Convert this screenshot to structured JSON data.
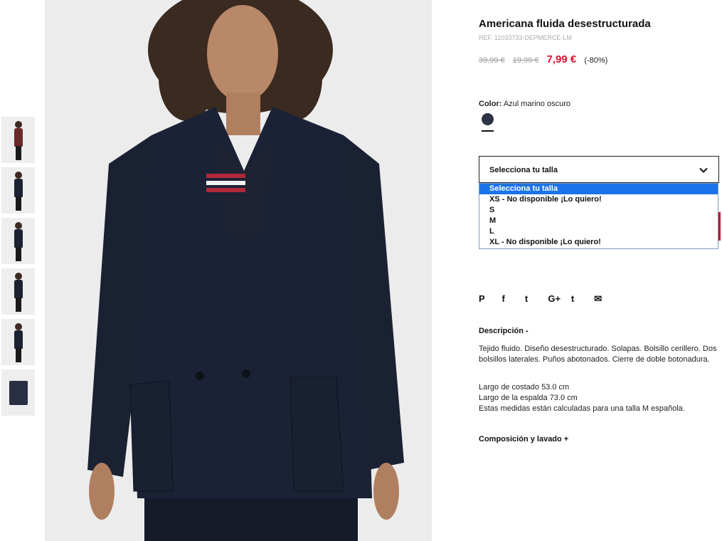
{
  "product": {
    "title": "Americana fluida desestructurada",
    "ref": "REF. 11033733-DEPMERCE-LM",
    "price_original": "39,99 €",
    "price_previous": "19,99 €",
    "price_current": "7,99 €",
    "discount": "(-80%)",
    "price_color": "#e3112a"
  },
  "color": {
    "label": "Color:",
    "value": "Azul marino oscuro",
    "swatch_color": "#2d3245"
  },
  "size": {
    "selected": "Selecciona tu talla",
    "options": [
      "Selecciona tu talla",
      "XS - No disponible ¡Lo quiero!",
      "S",
      "M",
      "L",
      "XL - No disponible ¡Lo quiero!"
    ]
  },
  "social": {
    "pinterest": "P",
    "facebook": "f",
    "twitter": "t",
    "googleplus": "G+",
    "tumblr": "t",
    "email": "✉"
  },
  "description": {
    "heading": "Descripción  -",
    "text": "Tejido fluido. Diseño desestructurado. Solapas. Bolsillo cerillero. Dos bolsillos laterales. Puños abotonados. Cierre de doble botonadura.",
    "measures": [
      "Largo de costado 53.0 cm",
      "Largo de la espalda 73.0 cm",
      "Estas medidas están calculadas para una talla M española."
    ]
  },
  "composition": {
    "heading": "Composición y lavado  +"
  },
  "thumbnails_count": 6
}
